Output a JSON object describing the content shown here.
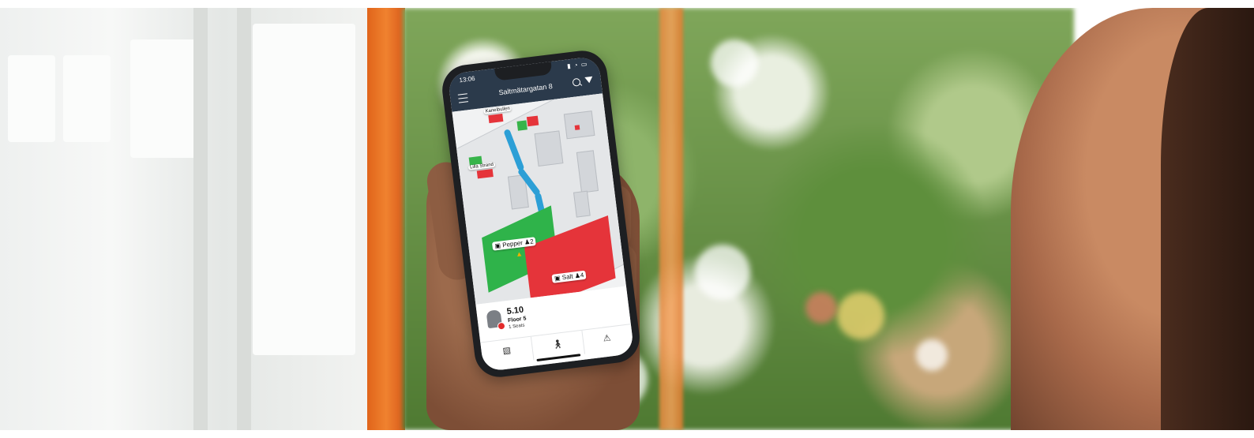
{
  "app": {
    "status_time": "13:06",
    "title": "Saltmätargatan 8"
  },
  "map": {
    "labels": {
      "top_room": "Kanelbullen",
      "left_room": "Lilla Strand",
      "pepper": "Pepper",
      "pepper_seats": "2",
      "salt": "Salt",
      "salt_seats": "4"
    },
    "colors": {
      "available": "#2fb34a",
      "occupied": "#e5343a",
      "route": "#2c9fd6"
    }
  },
  "desk_card": {
    "name": "5.10",
    "floor": "Floor 5",
    "seats": "1 Seats",
    "status_color": "#e32b2b"
  },
  "tabs": [
    {
      "icon": "map-icon"
    },
    {
      "icon": "walk-icon"
    },
    {
      "icon": "warning-icon"
    }
  ]
}
